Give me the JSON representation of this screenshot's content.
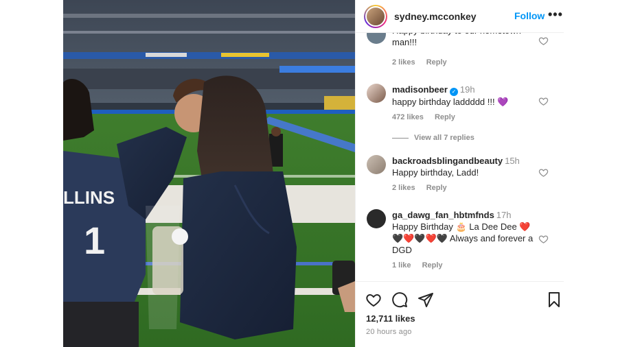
{
  "post": {
    "username": "sydney.mcconkey",
    "follow_label": "Follow",
    "more_label": "•••",
    "likes": "12,711 likes",
    "time_ago": "20 hours ago",
    "photo_jersey_text": "LLINS",
    "photo_jersey_number": "1"
  },
  "comments": [
    {
      "text": "Happy birthday to our hometown man!!!",
      "likes": "2 likes",
      "reply": "Reply"
    },
    {
      "user": "madisonbeer",
      "verified": true,
      "time": "19h",
      "text": "happy birthday laddddd !!! 💜",
      "likes": "472 likes",
      "reply": "Reply"
    },
    {
      "view_replies": "View all 7 replies"
    },
    {
      "user": "backroadsblingandbeauty",
      "time": "15h",
      "text": "Happy birthday, Ladd!",
      "likes": "2 likes",
      "reply": "Reply"
    },
    {
      "user": "ga_dawg_fan_hbtmfnds",
      "time": "17h",
      "text": "Happy Birthday 🎂 La Dee Dee ❤️ 🖤❤️🖤❤️🖤 Always and forever a DGD",
      "likes": "1 like",
      "reply": "Reply"
    }
  ],
  "colors": {
    "accent": "#0095f6",
    "secondary_text": "#8e8e8e",
    "divider": "#efefef"
  },
  "icons": [
    "heart-icon",
    "comment-icon",
    "share-icon",
    "bookmark-icon",
    "more-icon",
    "chevron-right-icon",
    "verified-icon"
  ]
}
